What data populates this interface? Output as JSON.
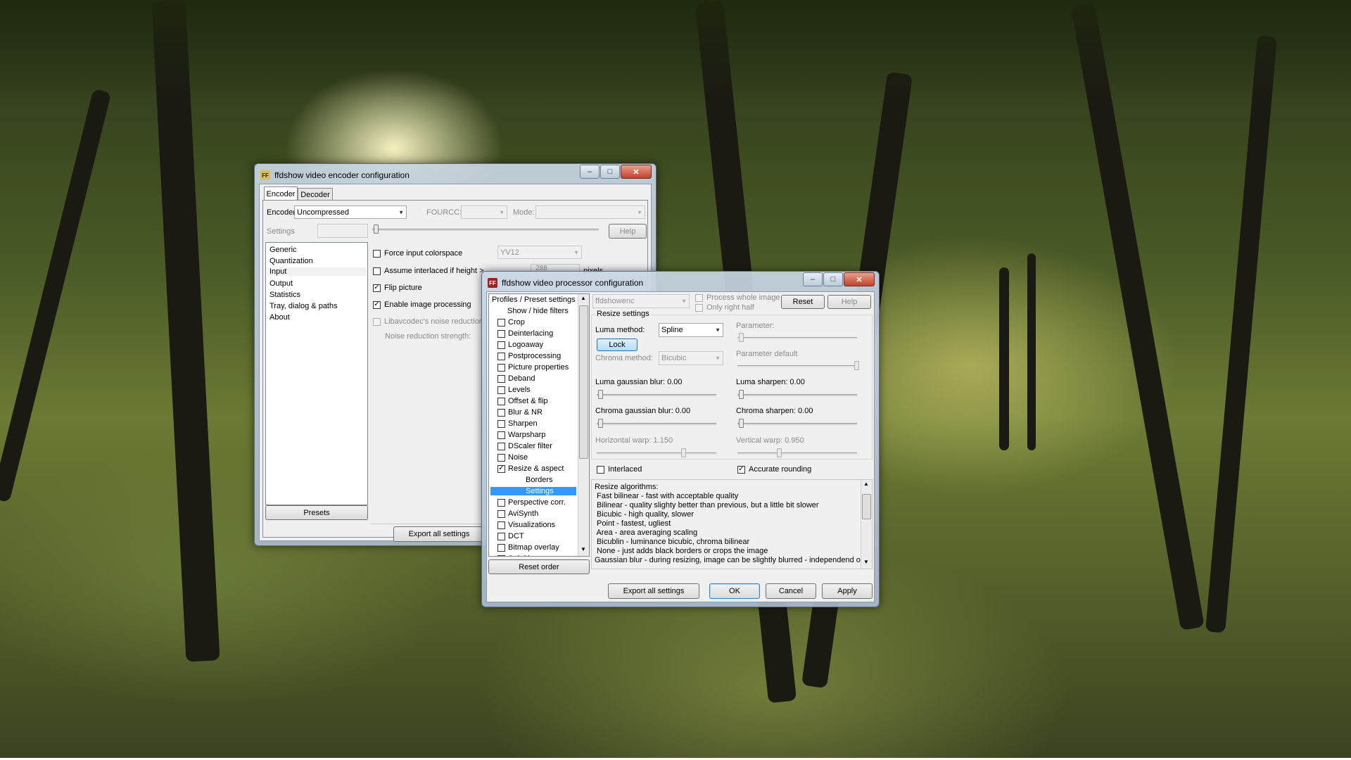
{
  "encoder_window": {
    "title": "ffdshow video encoder configuration",
    "app_icon": "ffdshow-icon",
    "tabs": [
      "Encoder",
      "Decoder"
    ],
    "encoder_label": "Encoder:",
    "encoder_value": "Uncompressed",
    "fourcc_label": "FOURCC:",
    "mode_label": "Mode:",
    "settings_label": "Settings",
    "help": "Help",
    "nav": [
      "Generic",
      "Quantization",
      "Input",
      "Output",
      "Statistics",
      "Tray, dialog & paths",
      "About"
    ],
    "force_colorspace": "Force input colorspace",
    "colorspace_value": "YV12",
    "assume_interlaced": "Assume interlaced if height >",
    "interlaced_height": "288",
    "pixels": "pixels",
    "flip_picture": "Flip picture",
    "enable_processing": "Enable image processing",
    "libav_noise": "Libavcodec's noise reduction",
    "noise_strength": "Noise reduction strength:",
    "presets": "Presets",
    "export_all": "Export all settings"
  },
  "processor_window": {
    "title": "ffdshow video processor configuration",
    "app_icon": "ffdshow-icon",
    "tree_items": [
      {
        "label": "Profiles / Preset settings",
        "type": "header"
      },
      {
        "label": "Show / hide filters",
        "type": "sub"
      },
      {
        "label": "Crop",
        "type": "check",
        "checked": false
      },
      {
        "label": "Deinterlacing",
        "type": "check",
        "checked": false
      },
      {
        "label": "Logoaway",
        "type": "check",
        "checked": false
      },
      {
        "label": "Postprocessing",
        "type": "check",
        "checked": false
      },
      {
        "label": "Picture properties",
        "type": "check",
        "checked": false
      },
      {
        "label": "Deband",
        "type": "check",
        "checked": false
      },
      {
        "label": "Levels",
        "type": "check",
        "checked": false
      },
      {
        "label": "Offset & flip",
        "type": "check",
        "checked": false
      },
      {
        "label": "Blur & NR",
        "type": "check",
        "checked": false
      },
      {
        "label": "Sharpen",
        "type": "check",
        "checked": false
      },
      {
        "label": "Warpsharp",
        "type": "check",
        "checked": false
      },
      {
        "label": "DScaler filter",
        "type": "check",
        "checked": false
      },
      {
        "label": "Noise",
        "type": "check",
        "checked": false
      },
      {
        "label": "Resize & aspect",
        "type": "check",
        "checked": true
      },
      {
        "label": "Borders",
        "type": "sub2"
      },
      {
        "label": "Settings",
        "type": "sub2",
        "selected": true
      },
      {
        "label": "Perspective corr.",
        "type": "check",
        "checked": false
      },
      {
        "label": "AviSynth",
        "type": "check",
        "checked": false
      },
      {
        "label": "Visualizations",
        "type": "check",
        "checked": false
      },
      {
        "label": "DCT",
        "type": "check",
        "checked": false
      },
      {
        "label": "Bitmap overlay",
        "type": "check",
        "checked": false
      },
      {
        "label": "Subtitles",
        "type": "check",
        "checked": false
      }
    ],
    "reset_order": "Reset order",
    "profile_value": "ffdshowenc",
    "process_whole": "Process whole image",
    "only_right_half": "Only right half",
    "reset": "Reset",
    "help": "Help",
    "section_title": "Resize settings",
    "luma_method_label": "Luma method:",
    "luma_method_value": "Spline",
    "lock": "Lock",
    "chroma_method_label": "Chroma method:",
    "chroma_method_value": "Bicubic",
    "parameter": "Parameter:",
    "parameter_default": "Parameter default",
    "luma_blur": "Luma gaussian blur: 0.00",
    "luma_sharpen": "Luma sharpen: 0.00",
    "chroma_blur": "Chroma gaussian blur: 0.00",
    "chroma_sharpen": "Chroma sharpen: 0.00",
    "horizontal_warp": "Horizontal warp: 1.150",
    "vertical_warp": "Vertical warp: 0.950",
    "interlaced": "Interlaced",
    "accurate_rounding": "Accurate rounding",
    "algorithms_text": [
      "Resize algorithms:",
      " Fast bilinear - fast with acceptable quality",
      " Bilinear - quality slighty better than previous, but a little bit slower",
      " Bicubic - high quality, slower",
      " Point - fastest, ugliest",
      " Area - area averaging scaling",
      " Bicublin - luminance bicubic, chroma bilinear",
      " None - just adds black borders or crops the image",
      "Gaussian blur - during resizing, image can be slightly blurred - independend on"
    ],
    "export_all": "Export all settings",
    "ok": "OK",
    "cancel": "Cancel",
    "apply": "Apply"
  }
}
